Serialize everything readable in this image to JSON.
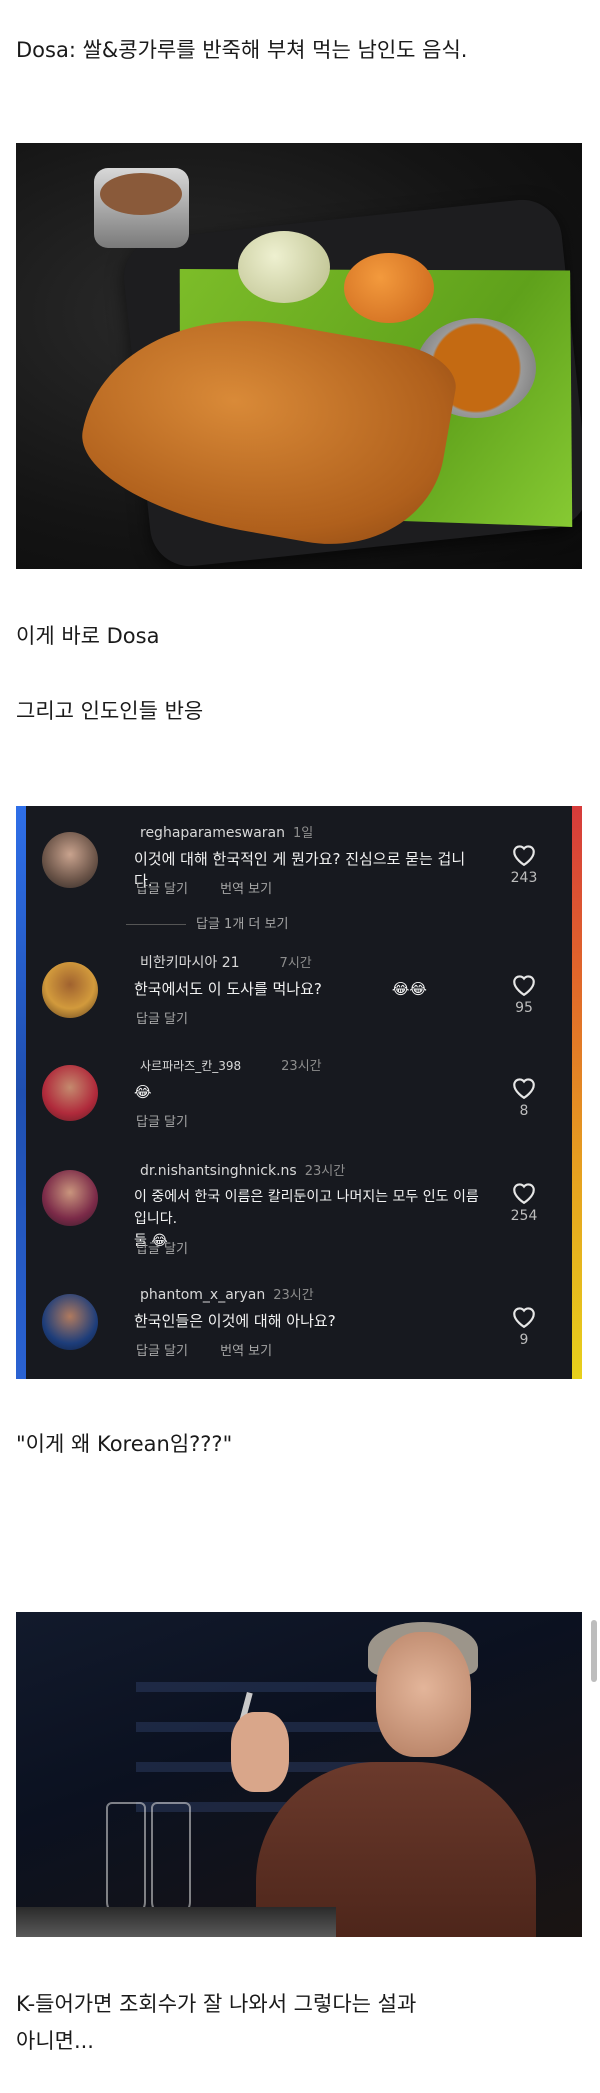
{
  "post": {
    "line1": "Dosa: 쌀&콩가루를 반죽해 부쳐 먹는 남인도 음식.",
    "line2": "이게 바로 Dosa",
    "line3": "그리고 인도인들 반응",
    "line4": "\"이게 왜 Korean임???\"",
    "line5": "K-들어가면 조회수가 잘 나와서 그렇다는 설과",
    "line6": "아니면..."
  },
  "comments": {
    "reply_label": "답글 달기",
    "translate_label": "번역 보기",
    "more_replies": "답글 1개 더 보기",
    "items": [
      {
        "user": "reghaparameswaran",
        "time": "1일",
        "text": "이것에 대해 한국적인 게 뭔가요? 진심으로 묻는 겁니다.",
        "likes": "243"
      },
      {
        "user": "비한키마시아 21",
        "time": "7시간",
        "text": "한국에서도 이 도사를 먹나요?",
        "emoji": "😂😂",
        "likes": "95"
      },
      {
        "user": "사르파라즈_칸_398",
        "time": "23시간",
        "text": "😂",
        "likes": "8"
      },
      {
        "user": "dr.nishantsinghnick.ns",
        "time": "23시간",
        "text": "이 중에서 한국 이름은 칼리둔이고 나머지는 모두 인도 이름입니다.",
        "text2": "둘 😂",
        "likes": "254"
      },
      {
        "user": "phantom_x_aryan",
        "time": "23시간",
        "text": "한국인들은 이것에 대해 아나요?",
        "likes": "9"
      }
    ]
  },
  "icons": {
    "like": "heart-icon"
  }
}
